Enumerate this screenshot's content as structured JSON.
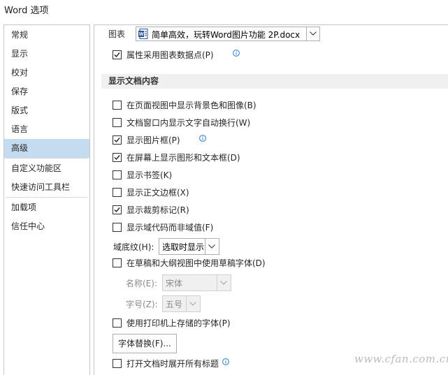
{
  "window": {
    "title": "Word 选项"
  },
  "sidebar": {
    "items": [
      {
        "label": "常规"
      },
      {
        "label": "显示"
      },
      {
        "label": "校对"
      },
      {
        "label": "保存"
      },
      {
        "label": "版式"
      },
      {
        "label": "语言"
      },
      {
        "label": "高级",
        "selected": true
      },
      {
        "label": "自定义功能区"
      },
      {
        "label": "快速访问工具栏"
      },
      {
        "label": "加载项"
      },
      {
        "label": "信任中心"
      }
    ]
  },
  "chart_section": {
    "label": "图表",
    "document_select": {
      "value": "简单高效，玩转Word图片功能    2P.docx"
    },
    "options": [
      {
        "label": "属性采用图表数据点(P)",
        "checked": true,
        "info_icon": true
      }
    ]
  },
  "display_section": {
    "header": "显示文档内容",
    "options": [
      {
        "label": "在页面视图中显示背景色和图像(B)",
        "checked": false
      },
      {
        "label": "文档窗口内显示文字自动换行(W)",
        "checked": false
      },
      {
        "label": "显示图片框(P)",
        "checked": true,
        "info_icon": true
      },
      {
        "label": "在屏幕上显示图形和文本框(D)",
        "checked": true
      },
      {
        "label": "显示书签(K)",
        "checked": false
      },
      {
        "label": "显示正文边框(X)",
        "checked": false
      },
      {
        "label": "显示裁剪标记(R)",
        "checked": true
      },
      {
        "label": "显示域代码而非域值(F)",
        "checked": false
      }
    ],
    "field_shading": {
      "label": "域底纹(H):",
      "value": "选取时显示"
    },
    "draft_font": {
      "label": "在草稿和大纲视图中使用草稿字体(D)",
      "checked": false
    },
    "font_name": {
      "label": "名称(E):",
      "value": "宋体"
    },
    "font_size": {
      "label": "字号(Z):",
      "value": "五号"
    },
    "printer_fonts": {
      "label": "使用打印机上存储的字体(P)",
      "checked": false
    },
    "font_substitution_button": "字体替换(F)...",
    "expand_headings": {
      "label": "打开文档时展开所有标题",
      "checked": false,
      "info_icon": true
    }
  },
  "watermark": {
    "text": "www.cfan.com.cn"
  },
  "colors": {
    "selected_nav": "#c5dbf0",
    "section_header_bg": "#f0f0f0",
    "info_icon": "#2b79d0"
  }
}
